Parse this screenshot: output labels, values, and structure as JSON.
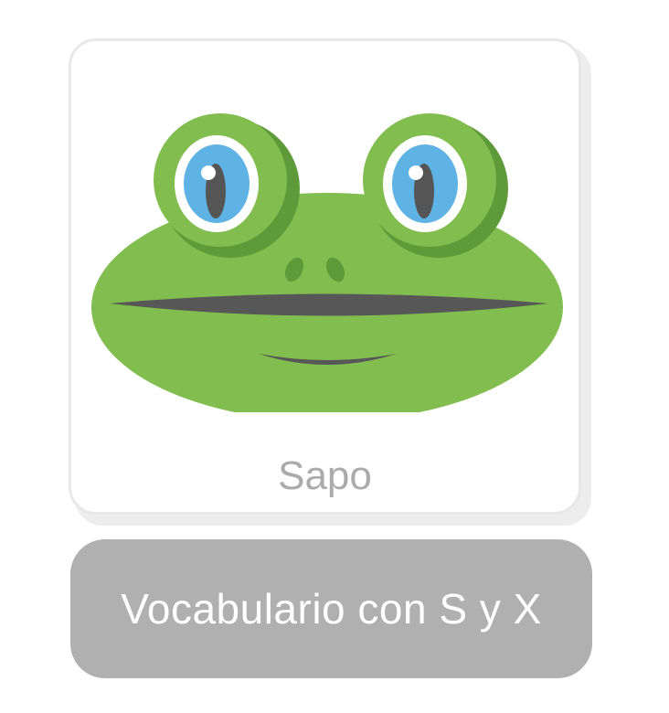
{
  "card": {
    "label": "Sapo",
    "image_icon": "frog-face-icon"
  },
  "banner": {
    "title": "Vocabulario con S y X"
  },
  "colors": {
    "frog_green": "#82bd50",
    "frog_dark_green": "#5f9a3a",
    "eye_blue": "#5fb3e4",
    "pupil_gray": "#555555",
    "mouth_gray": "#575757",
    "banner_gray": "#b0b0b0",
    "label_gray": "#ababab"
  }
}
